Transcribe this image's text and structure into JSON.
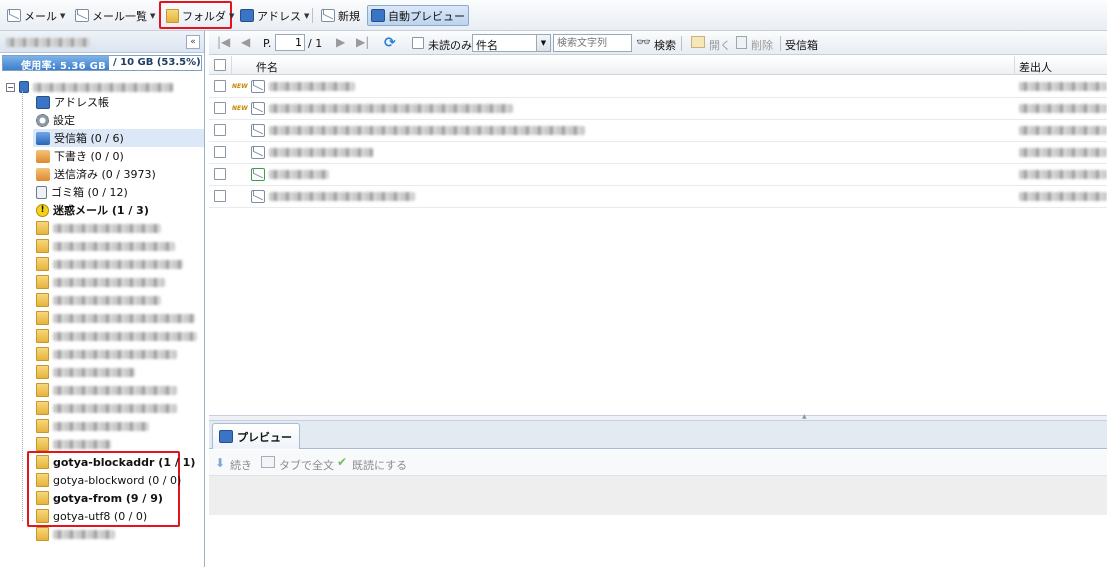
{
  "toolbar": {
    "mail": "メール",
    "mail_list": "メール一覧",
    "folder": "フォルダ",
    "address": "アドレス",
    "new": "新規",
    "auto_preview": "自動プレビュー"
  },
  "left": {
    "quota_used": "使用率: 5.36 GB",
    "quota_total": "/ 10 GB (53.5%)",
    "quota_percent": 53.5,
    "tree": [
      {
        "label": "アドレス帳",
        "icon": "address-book-icon"
      },
      {
        "label": "設定",
        "icon": "gear-icon"
      },
      {
        "label": "受信箱 (0 / 6)",
        "icon": "inbox-icon"
      },
      {
        "label": "下書き (0 / 0)",
        "icon": "drafts-icon"
      },
      {
        "label": "送信済み (0 / 3973)",
        "icon": "sent-icon"
      },
      {
        "label": "ゴミ箱 (0 / 12)",
        "icon": "trash-icon"
      },
      {
        "label": "迷惑メール (1 / 3)",
        "icon": "spam-icon"
      }
    ],
    "custom_folders": [
      {
        "label": "gotya-blockaddr (1 / 1)"
      },
      {
        "label": "gotya-blockword (0 / 0)"
      },
      {
        "label": "gotya-from (9 / 9)"
      },
      {
        "label": "gotya-utf8 (0 / 0)"
      }
    ]
  },
  "grid": {
    "page_prefix": "P.",
    "page_value": "1",
    "page_total": "/ 1",
    "unread_only": "未読のみ",
    "search_field": "件名",
    "search_placeholder": "検索文字列",
    "search_button": "検索",
    "open": "開く",
    "delete": "削除",
    "folder_name": "受信箱",
    "col_subject": "件名",
    "col_from": "差出人",
    "new_badge": "NEW"
  },
  "preview": {
    "tab": "プレビュー",
    "continue": "続き",
    "tab_fulltext": "タブで全文",
    "mark_read": "既読にする"
  }
}
